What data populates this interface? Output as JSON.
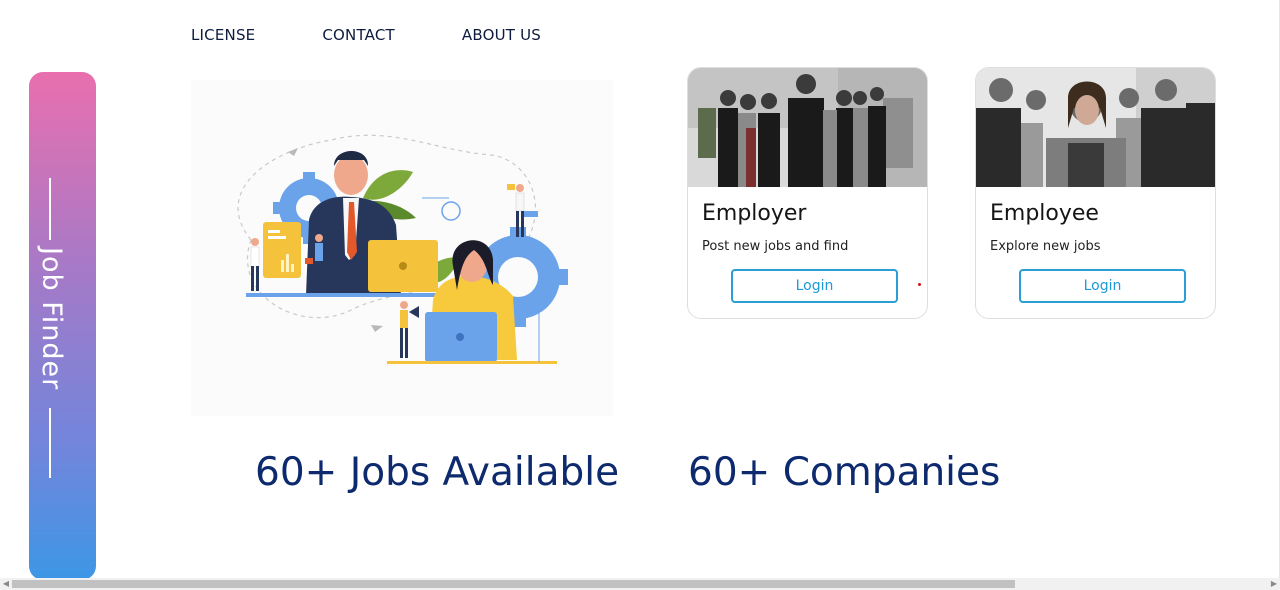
{
  "nav": {
    "items": [
      "LICENSE",
      "CONTACT",
      "ABOUT US"
    ]
  },
  "sidebar": {
    "brand": "Job Finder",
    "gradient": [
      "#e96fae",
      "#3d97e6"
    ]
  },
  "cards": [
    {
      "title": "Employer",
      "description": "Post new jobs and find",
      "button": "Login"
    },
    {
      "title": "Employee",
      "description": "Explore new jobs",
      "button": "Login"
    }
  ],
  "stats": {
    "jobs": "60+ Jobs Available",
    "companies": "60+ Companies"
  },
  "colors": {
    "accent": "#1d9ad8",
    "stat_text": "#0e2a6e",
    "nav_text": "#0d1b3f"
  },
  "scrollbar": {
    "horizontal_visible_fraction": 0.78
  }
}
